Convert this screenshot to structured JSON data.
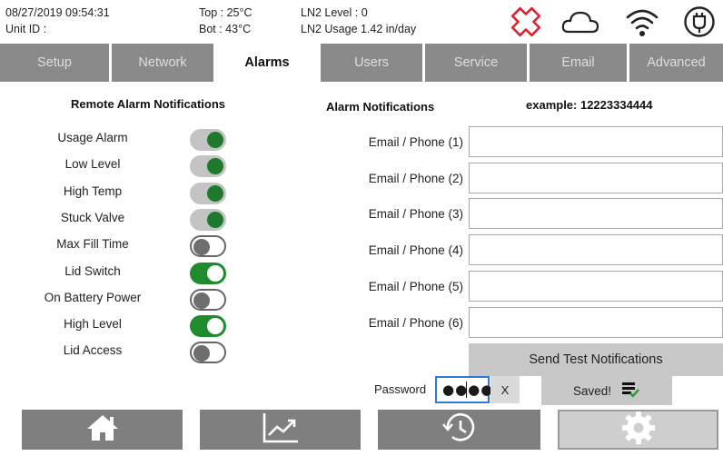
{
  "status": {
    "datetime": "08/27/2019 09:54:31",
    "unit_id": "Unit ID :",
    "top_temp": "Top : 25°C",
    "bot_temp": "Bot : 43°C",
    "ln2_level": "LN2 Level : 0",
    "ln2_usage": "LN2 Usage  1.42 in/day",
    "icons": [
      "alarm-cross-icon",
      "cloud-icon",
      "wifi-icon",
      "power-plug-icon"
    ]
  },
  "tabs": [
    {
      "label": "Setup",
      "active": false
    },
    {
      "label": "Network",
      "active": false
    },
    {
      "label": "Alarms",
      "active": true
    },
    {
      "label": "Users",
      "active": false
    },
    {
      "label": "Service",
      "active": false
    },
    {
      "label": "Email",
      "active": false
    },
    {
      "label": "Advanced",
      "active": false
    }
  ],
  "remote": {
    "title": "Remote Alarm Notifications",
    "items": [
      {
        "label": "Usage Alarm",
        "state": "on-grey"
      },
      {
        "label": "Low Level",
        "state": "on-grey"
      },
      {
        "label": "High Temp",
        "state": "on-grey"
      },
      {
        "label": "Stuck Valve",
        "state": "on-grey"
      },
      {
        "label": "Max Fill Time",
        "state": "off"
      },
      {
        "label": "Lid Switch",
        "state": "on"
      },
      {
        "label": "On Battery Power",
        "state": "off"
      },
      {
        "label": "High Level",
        "state": "on"
      },
      {
        "label": "Lid Access",
        "state": "off"
      }
    ]
  },
  "notifications": {
    "title": "Alarm Notifications",
    "example": "example:  12223334444",
    "fields": [
      {
        "label": "Email / Phone (1)",
        "value": ""
      },
      {
        "label": "Email / Phone (2)",
        "value": ""
      },
      {
        "label": "Email / Phone (3)",
        "value": ""
      },
      {
        "label": "Email / Phone (4)",
        "value": ""
      },
      {
        "label": "Email / Phone (5)",
        "value": ""
      },
      {
        "label": "Email / Phone (6)",
        "value": ""
      }
    ],
    "send_test_label": "Send Test Notifications"
  },
  "password": {
    "label": "Password",
    "value": "●●●●",
    "clear_label": "X"
  },
  "saved_label": "Saved!",
  "nav": [
    "home-icon",
    "chart-icon",
    "history-icon",
    "settings-gear-icon"
  ],
  "colors": {
    "accent_green": "#208a2e",
    "tab_bg": "#8a8a8a",
    "alarm_red": "#e0202e",
    "focus_blue": "#2e7bd6"
  }
}
